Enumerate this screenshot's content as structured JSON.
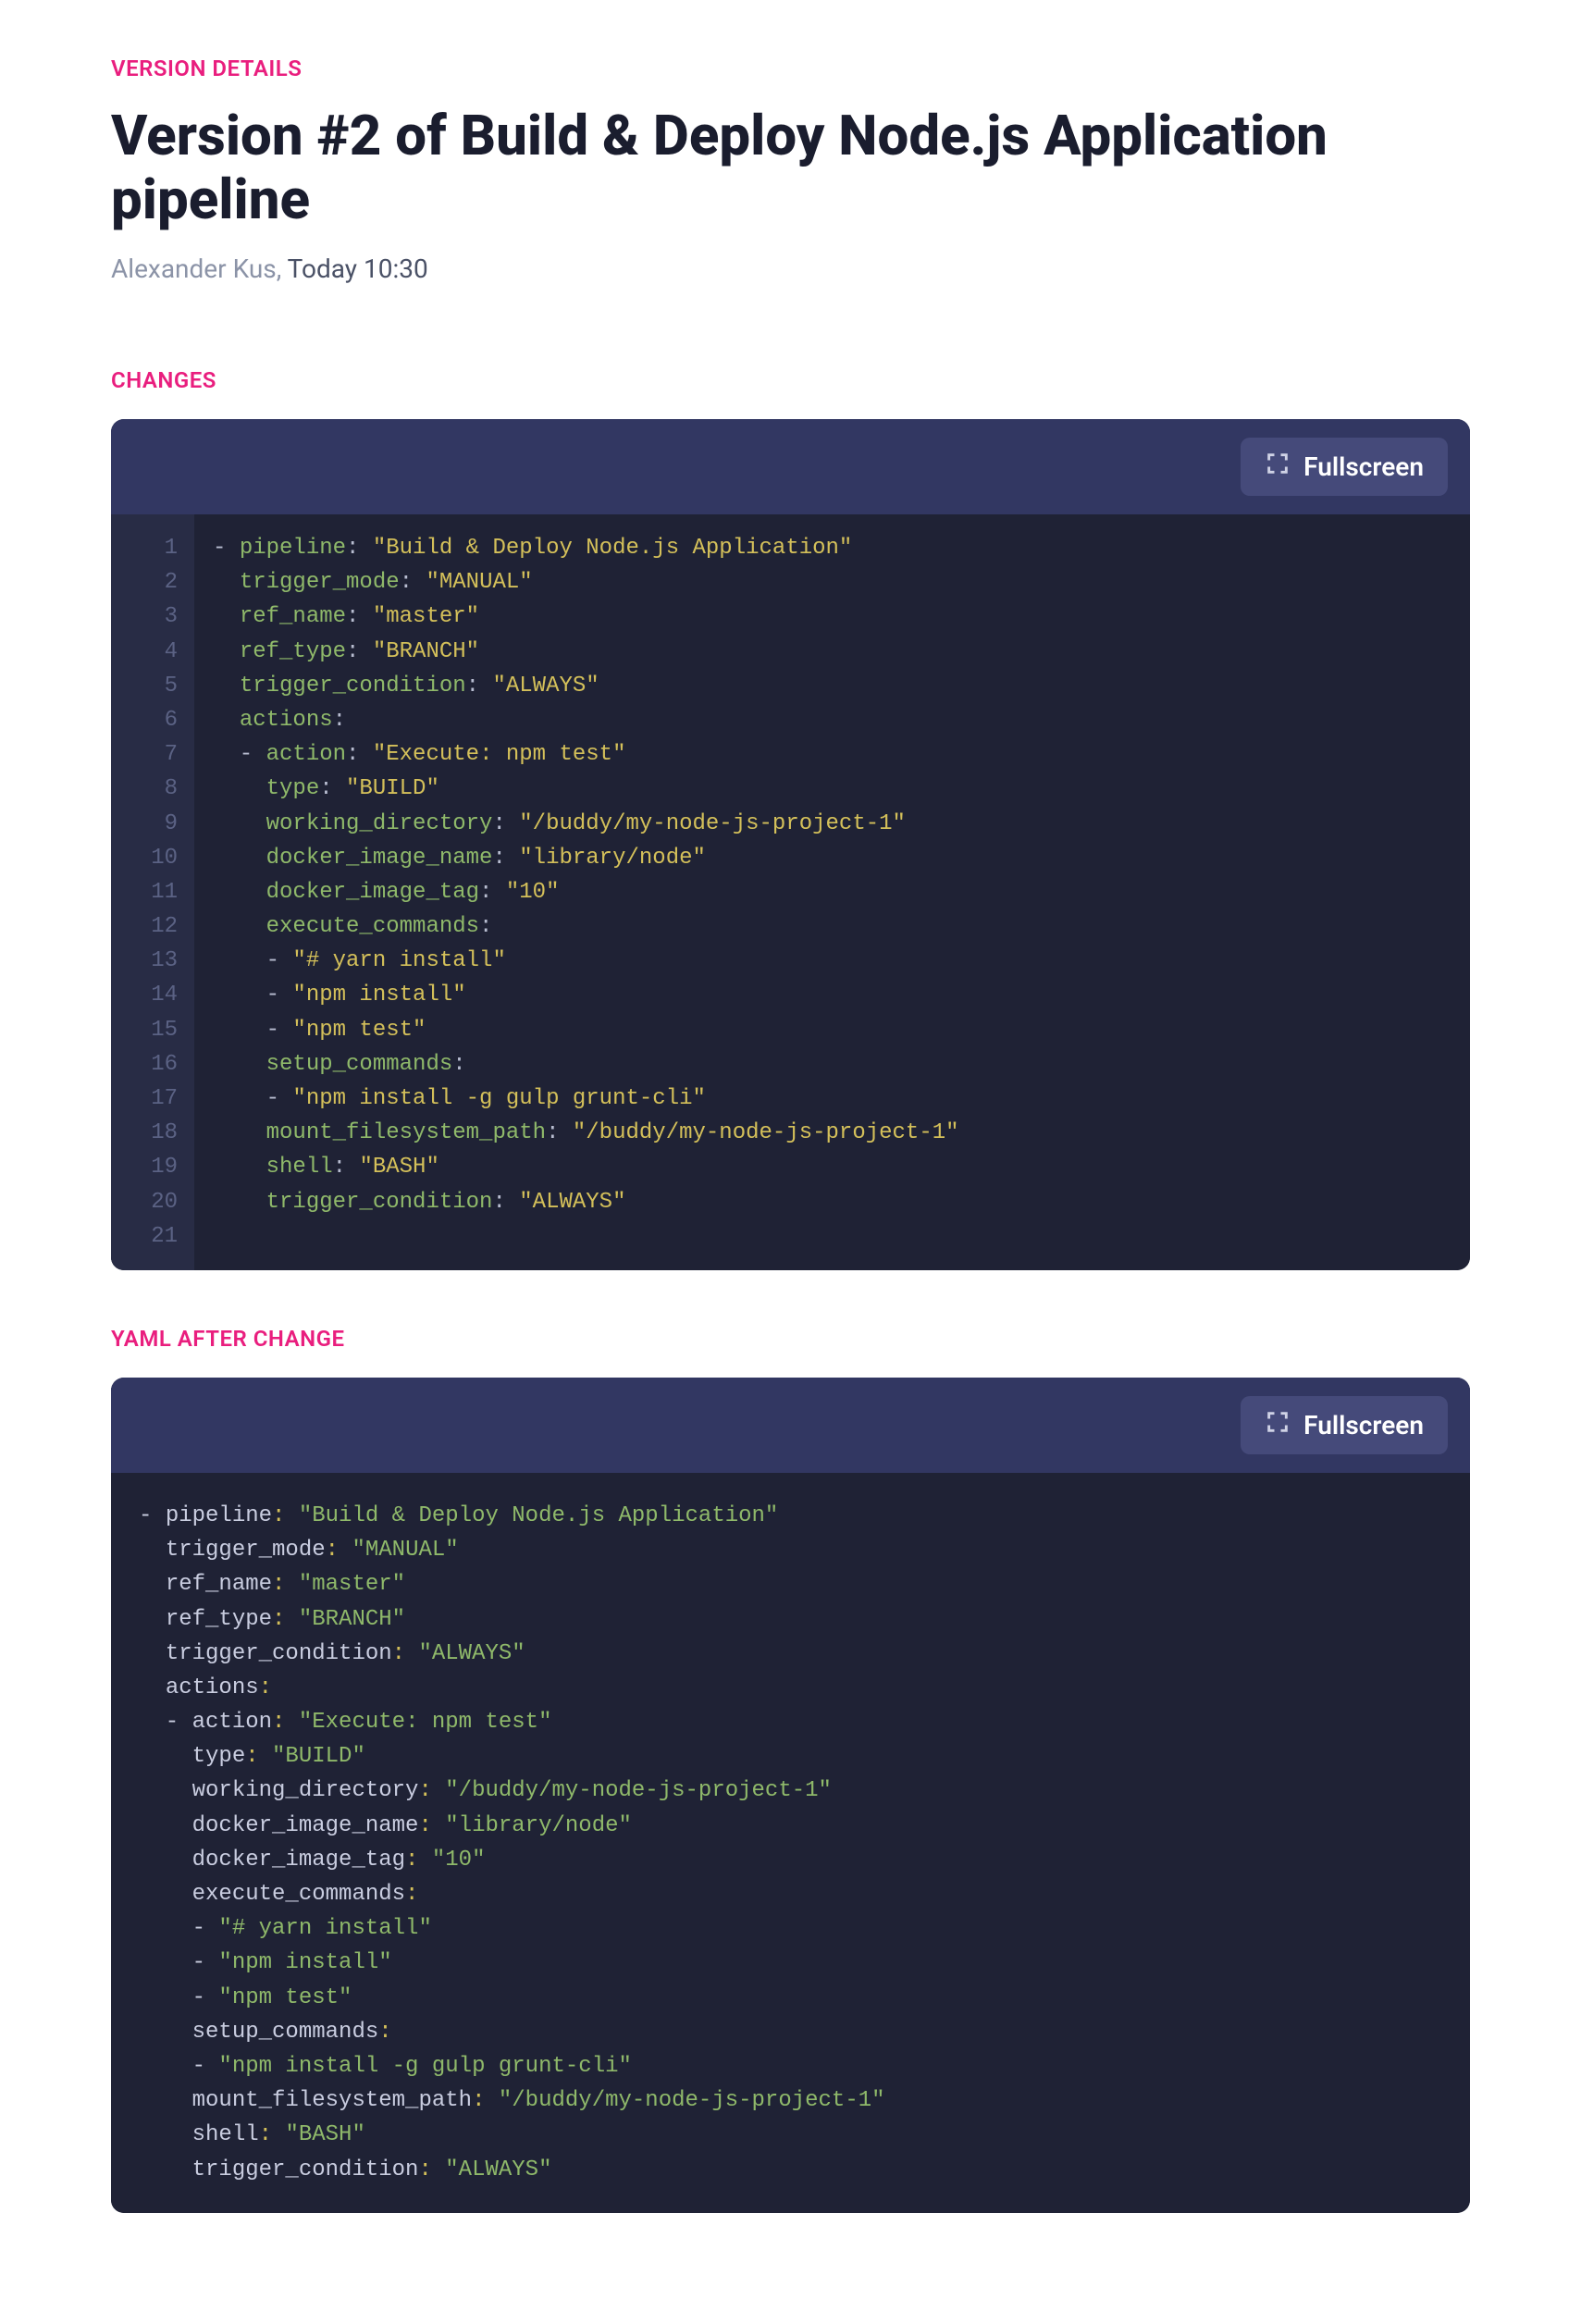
{
  "header": {
    "eyebrow": "VERSION DETAILS",
    "title": "Version #2 of Build & Deploy Node.js Application pipeline",
    "author": "Alexander Kus",
    "timestamp": "Today 10:30"
  },
  "sections": {
    "changes": {
      "label": "CHANGES",
      "fullscreen_label": "Fullscreen"
    },
    "yaml_after": {
      "label": "YAML AFTER CHANGE",
      "fullscreen_label": "Fullscreen"
    }
  },
  "changes_code": {
    "line_count": 21,
    "lines": [
      {
        "prefix": "- ",
        "key": "pipeline",
        "value": "\"Build & Deploy Node.js Application\"",
        "indent": 0
      },
      {
        "prefix": "  ",
        "key": "trigger_mode",
        "value": "\"MANUAL\"",
        "indent": 0
      },
      {
        "prefix": "  ",
        "key": "ref_name",
        "value": "\"master\"",
        "indent": 0
      },
      {
        "prefix": "  ",
        "key": "ref_type",
        "value": "\"BRANCH\"",
        "indent": 0
      },
      {
        "prefix": "  ",
        "key": "trigger_condition",
        "value": "\"ALWAYS\"",
        "indent": 0
      },
      {
        "prefix": "  ",
        "key": "actions",
        "value": null,
        "indent": 0
      },
      {
        "prefix": "  - ",
        "key": "action",
        "value": "\"Execute: npm test\"",
        "indent": 0
      },
      {
        "prefix": "    ",
        "key": "type",
        "value": "\"BUILD\"",
        "indent": 0
      },
      {
        "prefix": "    ",
        "key": "working_directory",
        "value": "\"/buddy/my-node-js-project-1\"",
        "indent": 0
      },
      {
        "prefix": "    ",
        "key": "docker_image_name",
        "value": "\"library/node\"",
        "indent": 0
      },
      {
        "prefix": "    ",
        "key": "docker_image_tag",
        "value": "\"10\"",
        "indent": 0
      },
      {
        "prefix": "    ",
        "key": "execute_commands",
        "value": null,
        "indent": 0
      },
      {
        "prefix": "    ",
        "key": "- \"# yarn install\"",
        "value": "__list__",
        "indent": 0
      },
      {
        "prefix": "    ",
        "key": "- \"npm install\"",
        "value": "__list__",
        "indent": 0
      },
      {
        "prefix": "    ",
        "key": "- \"npm test\"",
        "value": "__list__",
        "indent": 0
      },
      {
        "prefix": "    ",
        "key": "setup_commands",
        "value": null,
        "indent": 0
      },
      {
        "prefix": "    ",
        "key": "- \"npm install -g gulp grunt-cli\"",
        "value": "__list__",
        "indent": 0
      },
      {
        "prefix": "    ",
        "key": "mount_filesystem_path",
        "value": "\"/buddy/my-node-js-project-1\"",
        "indent": 0
      },
      {
        "prefix": "    ",
        "key": "shell",
        "value": "\"BASH\"",
        "indent": 0
      },
      {
        "prefix": "    ",
        "key": "trigger_condition",
        "value": "\"ALWAYS\"",
        "indent": 0
      },
      {
        "prefix": "",
        "key": "",
        "value": "__blank__",
        "indent": 0
      }
    ]
  },
  "yaml_after_code": {
    "lines": [
      {
        "prefix": "- ",
        "key": "pipeline",
        "value": "\"Build & Deploy Node.js Application\""
      },
      {
        "prefix": "  ",
        "key": "trigger_mode",
        "value": "\"MANUAL\""
      },
      {
        "prefix": "  ",
        "key": "ref_name",
        "value": "\"master\""
      },
      {
        "prefix": "  ",
        "key": "ref_type",
        "value": "\"BRANCH\""
      },
      {
        "prefix": "  ",
        "key": "trigger_condition",
        "value": "\"ALWAYS\""
      },
      {
        "prefix": "  ",
        "key": "actions",
        "value": null
      },
      {
        "prefix": "  - ",
        "key": "action",
        "value": "\"Execute: npm test\""
      },
      {
        "prefix": "    ",
        "key": "type",
        "value": "\"BUILD\""
      },
      {
        "prefix": "    ",
        "key": "working_directory",
        "value": "\"/buddy/my-node-js-project-1\""
      },
      {
        "prefix": "    ",
        "key": "docker_image_name",
        "value": "\"library/node\""
      },
      {
        "prefix": "    ",
        "key": "docker_image_tag",
        "value": "\"10\""
      },
      {
        "prefix": "    ",
        "key": "execute_commands",
        "value": null
      },
      {
        "prefix": "    ",
        "key": "- \"# yarn install\"",
        "value": "__list__"
      },
      {
        "prefix": "    ",
        "key": "- \"npm install\"",
        "value": "__list__"
      },
      {
        "prefix": "    ",
        "key": "- \"npm test\"",
        "value": "__list__"
      },
      {
        "prefix": "    ",
        "key": "setup_commands",
        "value": null
      },
      {
        "prefix": "    ",
        "key": "- \"npm install -g gulp grunt-cli\"",
        "value": "__list__"
      },
      {
        "prefix": "    ",
        "key": "mount_filesystem_path",
        "value": "\"/buddy/my-node-js-project-1\""
      },
      {
        "prefix": "    ",
        "key": "shell",
        "value": "\"BASH\""
      },
      {
        "prefix": "    ",
        "key": "trigger_condition",
        "value": "\"ALWAYS\""
      }
    ]
  }
}
